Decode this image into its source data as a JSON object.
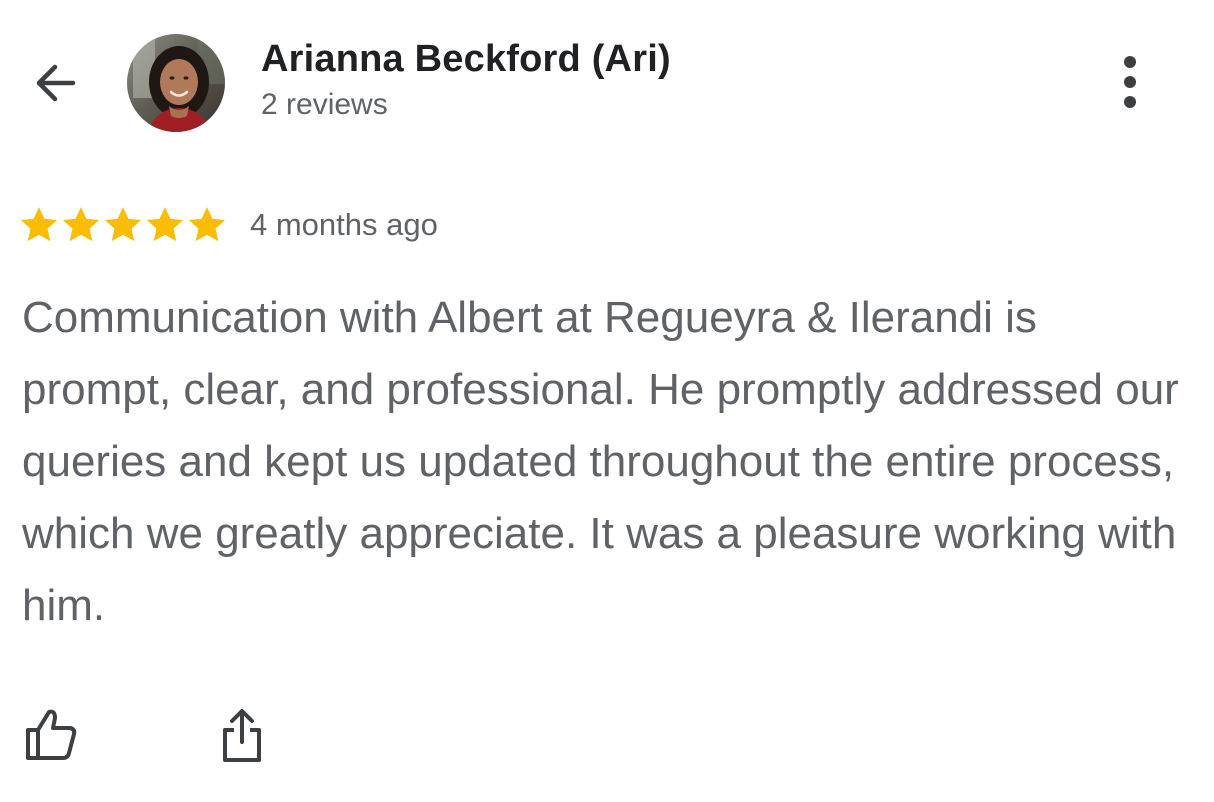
{
  "reviewer": {
    "name": "Arianna Beckford (Ari)",
    "review_count": "2 reviews"
  },
  "review": {
    "rating": 5,
    "rating_max": 5,
    "time": "4 months ago",
    "text": "Communication with Albert at Regueyra & Ilerandi is prompt, clear, and professional. He promptly addressed our queries and kept us updated throughout the entire process, which we greatly appreciate. It was a pleasure working with him."
  },
  "icons": {
    "back": "arrow-back-icon",
    "more": "more-vertical-icon",
    "like": "thumb-up-icon",
    "share": "share-icon",
    "star": "star-icon"
  },
  "colors": {
    "star": "#fbbc04",
    "name": "#202124",
    "secondary_text": "#5f6368",
    "icon": "#3c4043"
  }
}
